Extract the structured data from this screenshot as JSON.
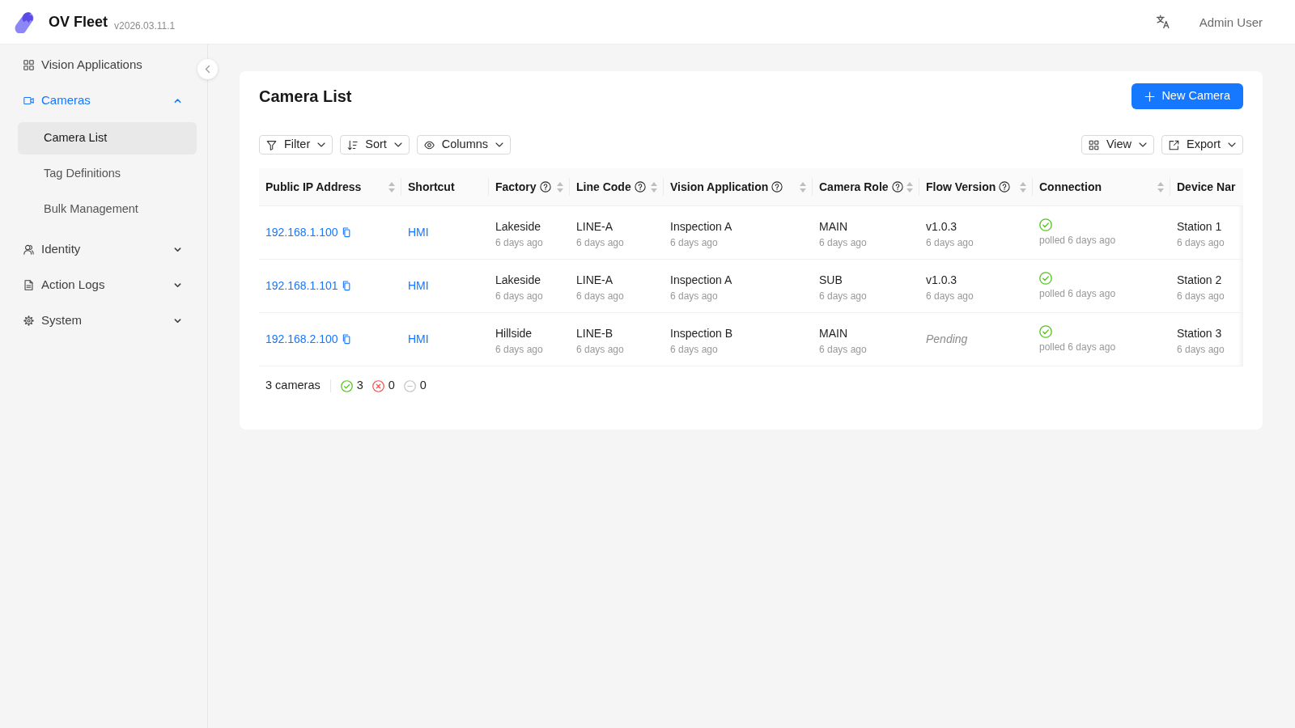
{
  "header": {
    "app_name": "OV Fleet",
    "version": "v2026.03.11.1",
    "user": "Admin User"
  },
  "sidebar": {
    "items": [
      {
        "kind": "link",
        "label": "Vision Applications",
        "selected": false
      },
      {
        "kind": "group",
        "label": "Cameras",
        "selected": true,
        "expanded": true,
        "children": [
          {
            "label": "Camera List",
            "selected": true
          },
          {
            "label": "Tag Definitions",
            "selected": false
          },
          {
            "label": "Bulk Management",
            "selected": false
          }
        ]
      },
      {
        "kind": "group",
        "label": "Identity",
        "selected": false,
        "expanded": false
      },
      {
        "kind": "group",
        "label": "Action Logs",
        "selected": false,
        "expanded": false
      },
      {
        "kind": "group",
        "label": "System",
        "selected": false,
        "expanded": false
      }
    ]
  },
  "page": {
    "title": "Camera List",
    "primary_action": "New Camera",
    "toolbar_left": [
      {
        "kind": "filter",
        "label": "Filter"
      },
      {
        "kind": "sort",
        "label": "Sort"
      },
      {
        "kind": "columns",
        "label": "Columns"
      }
    ],
    "toolbar_right": [
      {
        "kind": "view",
        "label": "View"
      },
      {
        "kind": "export",
        "label": "Export"
      }
    ]
  },
  "table": {
    "columns": [
      {
        "label": "Public IP Address",
        "help": false,
        "sortable": true
      },
      {
        "label": "Shortcut",
        "help": false,
        "sortable": false
      },
      {
        "label": "Factory",
        "help": true,
        "sortable": true
      },
      {
        "label": "Line Code",
        "help": true,
        "sortable": true
      },
      {
        "label": "Vision Application",
        "help": true,
        "sortable": true
      },
      {
        "label": "Camera Role",
        "help": true,
        "sortable": true
      },
      {
        "label": "Flow Version",
        "help": true,
        "sortable": true
      },
      {
        "label": "Connection",
        "help": false,
        "sortable": true
      },
      {
        "label": "Device Nar",
        "help": false,
        "sortable": false
      }
    ],
    "rows": [
      {
        "ip_address": "192.168.1.100",
        "shortcut": "HMI",
        "factory": {
          "value": "Lakeside",
          "updated": "6 days ago"
        },
        "line_code": {
          "value": "LINE-A",
          "updated": "6 days ago"
        },
        "vision_application": {
          "value": "Inspection A",
          "updated": "6 days ago"
        },
        "camera_role": {
          "value": "MAIN",
          "updated": "6 days ago"
        },
        "flow_version": {
          "kind": "version",
          "value": "v1.0.3",
          "updated": "6 days ago"
        },
        "connection": {
          "connected": true,
          "polled": "polled 6 days ago"
        },
        "device_name": {
          "value": "Station 1",
          "updated": "6 days ago"
        }
      },
      {
        "ip_address": "192.168.1.101",
        "shortcut": "HMI",
        "factory": {
          "value": "Lakeside",
          "updated": "6 days ago"
        },
        "line_code": {
          "value": "LINE-A",
          "updated": "6 days ago"
        },
        "vision_application": {
          "value": "Inspection A",
          "updated": "6 days ago"
        },
        "camera_role": {
          "value": "SUB",
          "updated": "6 days ago"
        },
        "flow_version": {
          "kind": "version",
          "value": "v1.0.3",
          "updated": "6 days ago"
        },
        "connection": {
          "connected": true,
          "polled": "polled 6 days ago"
        },
        "device_name": {
          "value": "Station 2",
          "updated": "6 days ago"
        }
      },
      {
        "ip_address": "192.168.2.100",
        "shortcut": "HMI",
        "factory": {
          "value": "Hillside",
          "updated": "6 days ago"
        },
        "line_code": {
          "value": "LINE-B",
          "updated": "6 days ago"
        },
        "vision_application": {
          "value": "Inspection B",
          "updated": "6 days ago"
        },
        "camera_role": {
          "value": "MAIN",
          "updated": "6 days ago"
        },
        "flow_version": {
          "kind": "pending",
          "value": "Pending"
        },
        "connection": {
          "connected": true,
          "polled": "polled 6 days ago"
        },
        "device_name": {
          "value": "Station 3",
          "updated": "6 days ago"
        }
      }
    ]
  },
  "footer": {
    "count": "3 cameras",
    "statuses": [
      {
        "kind": "ok",
        "count": "3"
      },
      {
        "kind": "error",
        "count": "0"
      },
      {
        "kind": "none",
        "count": "0"
      }
    ]
  }
}
